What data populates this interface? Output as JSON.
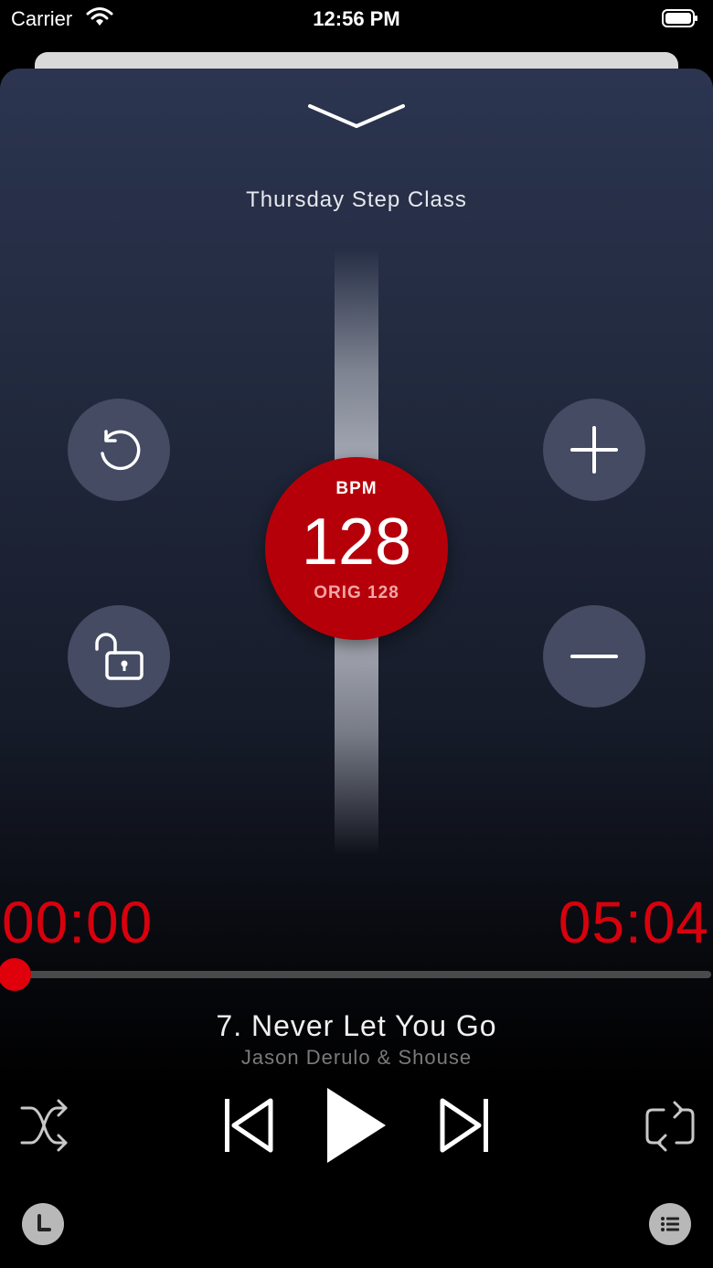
{
  "status_bar": {
    "carrier": "Carrier",
    "time": "12:56 PM"
  },
  "header": {
    "playlist_title": "Thursday Step Class"
  },
  "tempo": {
    "label": "BPM",
    "value": "128",
    "original": "ORIG 128"
  },
  "playback": {
    "elapsed": "00:00",
    "remaining": "05:04",
    "progress": 0
  },
  "track": {
    "title": "7. Never Let You Go",
    "artist": "Jason Derulo & Shouse"
  },
  "icons": {
    "collapse": "chevron-down-icon",
    "reset": "reset-icon",
    "lock": "unlock-icon",
    "plus": "plus-icon",
    "minus": "minus-icon",
    "shuffle": "shuffle-icon",
    "previous": "skip-back-icon",
    "play": "play-icon",
    "next": "skip-forward-icon",
    "repeat": "repeat-icon",
    "history": "history-icon",
    "queue": "list-icon"
  },
  "colors": {
    "accent": "#d9000d",
    "dial": "#b5000a",
    "button": "#444b62"
  }
}
